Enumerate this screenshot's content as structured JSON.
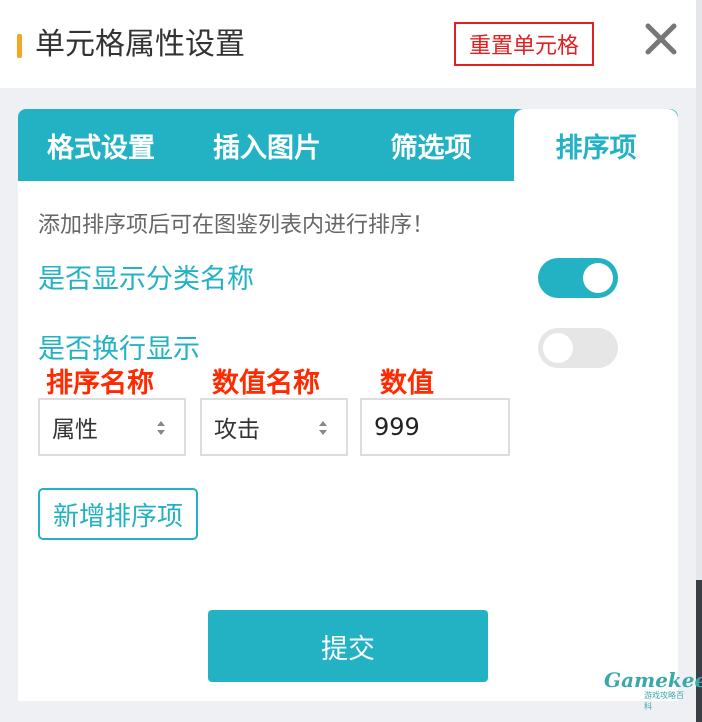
{
  "header": {
    "title": "单元格属性设置",
    "reset_label": "重置单元格",
    "close_icon": "close-icon"
  },
  "tabs": [
    {
      "label": "格式设置",
      "active": false
    },
    {
      "label": "插入图片",
      "active": false
    },
    {
      "label": "筛选项",
      "active": false
    },
    {
      "label": "排序项",
      "active": true
    }
  ],
  "sort": {
    "hint": "添加排序项后可在图鉴列表内进行排序！",
    "show_category_label": "是否显示分类名称",
    "show_category_on": true,
    "wrap_display_label": "是否换行显示",
    "wrap_display_on": false,
    "annotations": {
      "sort_name": "排序名称",
      "value_name": "数值名称",
      "value": "数值"
    },
    "row": {
      "sort_name_selected": "属性",
      "value_name_selected": "攻击",
      "value": "999"
    },
    "add_label": "新增排序项"
  },
  "submit_label": "提交",
  "logo": {
    "text": "Gamekee",
    "subtitle": "游戏攻略百科"
  },
  "colors": {
    "accent": "#22b2c4",
    "warning": "#f5a623",
    "annotation_red": "#ff2a00",
    "reset_red": "#e02020"
  }
}
